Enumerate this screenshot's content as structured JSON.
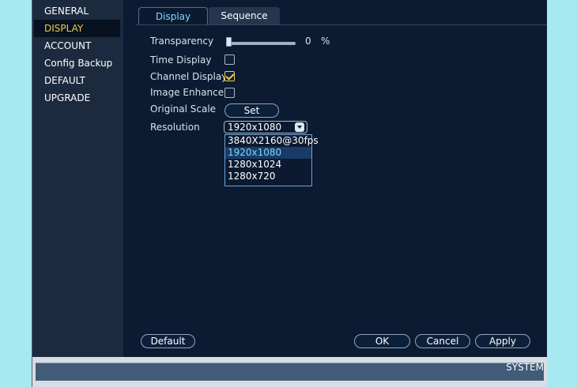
{
  "sidebar": {
    "items": [
      {
        "label": "GENERAL",
        "active": false
      },
      {
        "label": "DISPLAY",
        "active": true
      },
      {
        "label": "ACCOUNT",
        "active": false
      },
      {
        "label": "Config Backup",
        "active": false
      },
      {
        "label": "DEFAULT",
        "active": false
      },
      {
        "label": "UPGRADE",
        "active": false
      }
    ]
  },
  "tabs": [
    {
      "label": "Display",
      "active": true
    },
    {
      "label": "Sequence",
      "active": false
    }
  ],
  "settings": {
    "transparency": {
      "label": "Transparency",
      "value": "0",
      "unit": "%",
      "level": 0
    },
    "time_display": {
      "label": "Time Display",
      "checked": false
    },
    "channel_display": {
      "label": "Channel Display",
      "checked": true
    },
    "image_enhance": {
      "label": "Image Enhance",
      "checked": false
    },
    "original_scale": {
      "label": "Original Scale",
      "button_label": "Set"
    },
    "resolution": {
      "label": "Resolution",
      "value": "1920x1080",
      "options": [
        "3840X2160@30fps",
        "1920x1080",
        "1280x1024",
        "1280x720"
      ]
    }
  },
  "footer": {
    "default_label": "Default",
    "ok_label": "OK",
    "cancel_label": "Cancel",
    "apply_label": "Apply"
  },
  "bottom_bar": {
    "title": "SYSTEM"
  },
  "colors": {
    "accent": "#7fd9ff",
    "active_menu": "#f2c94c",
    "panel": "#0c1b31",
    "background": "#a8e8f0"
  }
}
